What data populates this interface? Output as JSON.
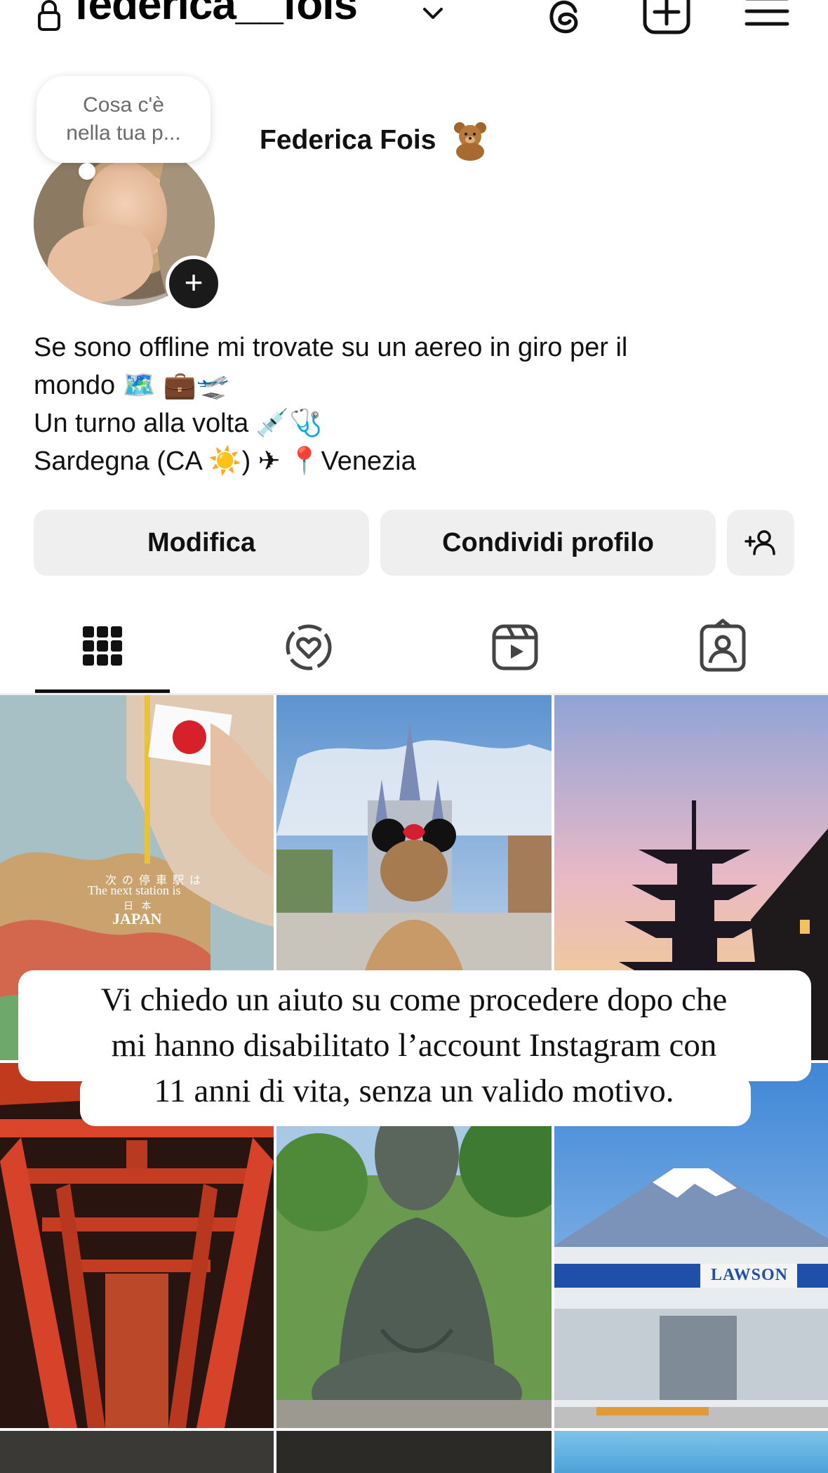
{
  "header": {
    "username": "federica__fois"
  },
  "profile": {
    "note_line1": "Cosa c'è",
    "note_line2": "nella tua p...",
    "display_name": "Federica Fois",
    "add_story_symbol": "+",
    "bio": {
      "line1": "Se sono offline mi trovate su un aereo in giro per il",
      "line2": "mondo 🗺️ 💼🛫",
      "line3": "Un turno alla volta 💉🩺",
      "line4": "Sardegna (CA ☀️) ✈ 📍Venezia"
    }
  },
  "buttons": {
    "edit": "Modifica",
    "share": "Condividi profilo"
  },
  "posts": {
    "tile1_line1": "次 の 停 車 駅 は",
    "tile1_line2": "The next station is",
    "tile1_line3": "日 本",
    "tile1_line4": "JAPAN",
    "store_sign": "LAWSON"
  },
  "overlay": {
    "line1": "Vi chiedo un aiuto su come procedere dopo che",
    "line2": "mi hanno disabilitato l’account Instagram con",
    "line3": "11 anni di vita, senza un valido motivo."
  },
  "icons": {
    "lock": "lock-icon",
    "chevron": "chevron-down-icon",
    "threads": "threads-icon",
    "create": "plus-square-icon",
    "menu": "hamburger-menu-icon",
    "add_person": "add-person-icon",
    "grid_tab": "grid-icon",
    "reposts_tab": "heart-circle-icon",
    "reels_tab": "reels-icon",
    "tagged_tab": "tagged-icon"
  }
}
